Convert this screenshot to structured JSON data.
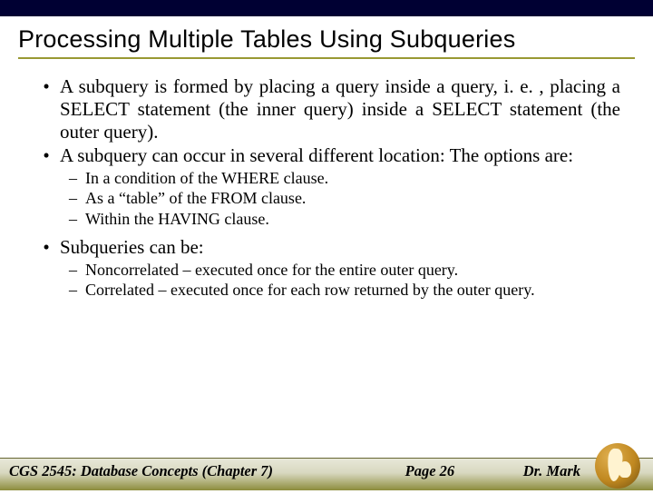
{
  "title": "Processing Multiple Tables Using Subqueries",
  "bullets": [
    {
      "text": "A subquery is formed by placing a query inside a query, i. e. , placing a SELECT statement (the inner query) inside a SELECT statement (the outer query).",
      "sub": []
    },
    {
      "text": "A subquery can occur in several different location: The options are:",
      "sub": [
        "In a condition of the WHERE clause.",
        "As a “table” of the FROM clause.",
        "Within the HAVING clause."
      ]
    },
    {
      "text": "Subqueries can be:",
      "sub": [
        "Noncorrelated – executed once for the entire outer query.",
        "Correlated – executed once for each row returned by the outer query."
      ]
    }
  ],
  "footer": {
    "left": "CGS 2545: Database Concepts  (Chapter 7)",
    "center": "Page 26",
    "right": "Dr. Mark"
  }
}
